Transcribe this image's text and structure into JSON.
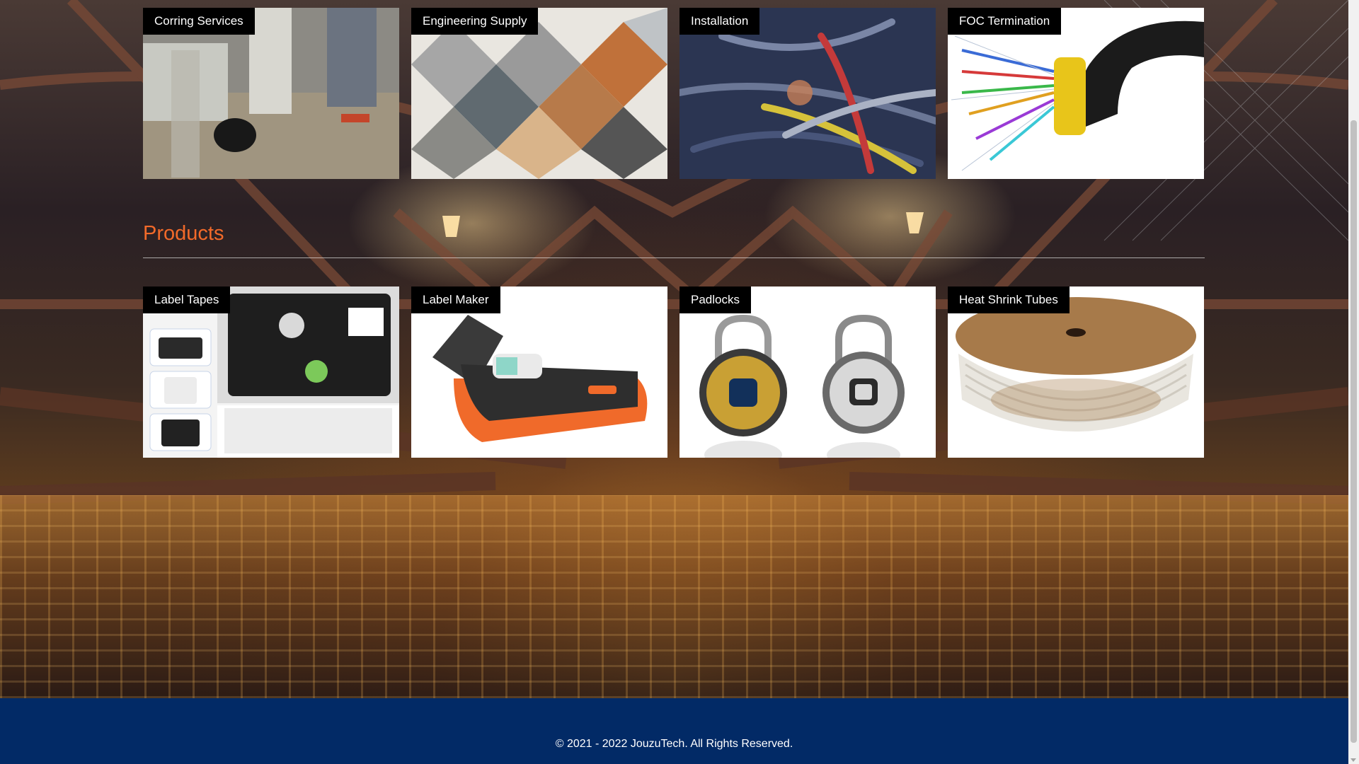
{
  "services": [
    {
      "label": "Corring Services",
      "icon": "core-drilling-photo"
    },
    {
      "label": "Engineering Supply",
      "icon": "construction-materials-photo"
    },
    {
      "label": "Installation",
      "icon": "cables-photo"
    },
    {
      "label": "FOC Termination",
      "icon": "fiber-optic-cable-photo"
    }
  ],
  "products_section": {
    "title": "Products"
  },
  "products": [
    {
      "label": "Label Tapes",
      "icon": "label-tape-cartridge-photo"
    },
    {
      "label": "Label Maker",
      "icon": "label-printer-photo"
    },
    {
      "label": "Padlocks",
      "icon": "fingerprint-padlock-photo"
    },
    {
      "label": "Heat Shrink Tubes",
      "icon": "heat-shrink-spool-photo"
    }
  ],
  "footer": {
    "copyright": "© 2021 - 2022 JouzuTech. All Rights Reserved.",
    "background_color": "#022a66"
  },
  "colors": {
    "accent": "#f26a2a"
  }
}
